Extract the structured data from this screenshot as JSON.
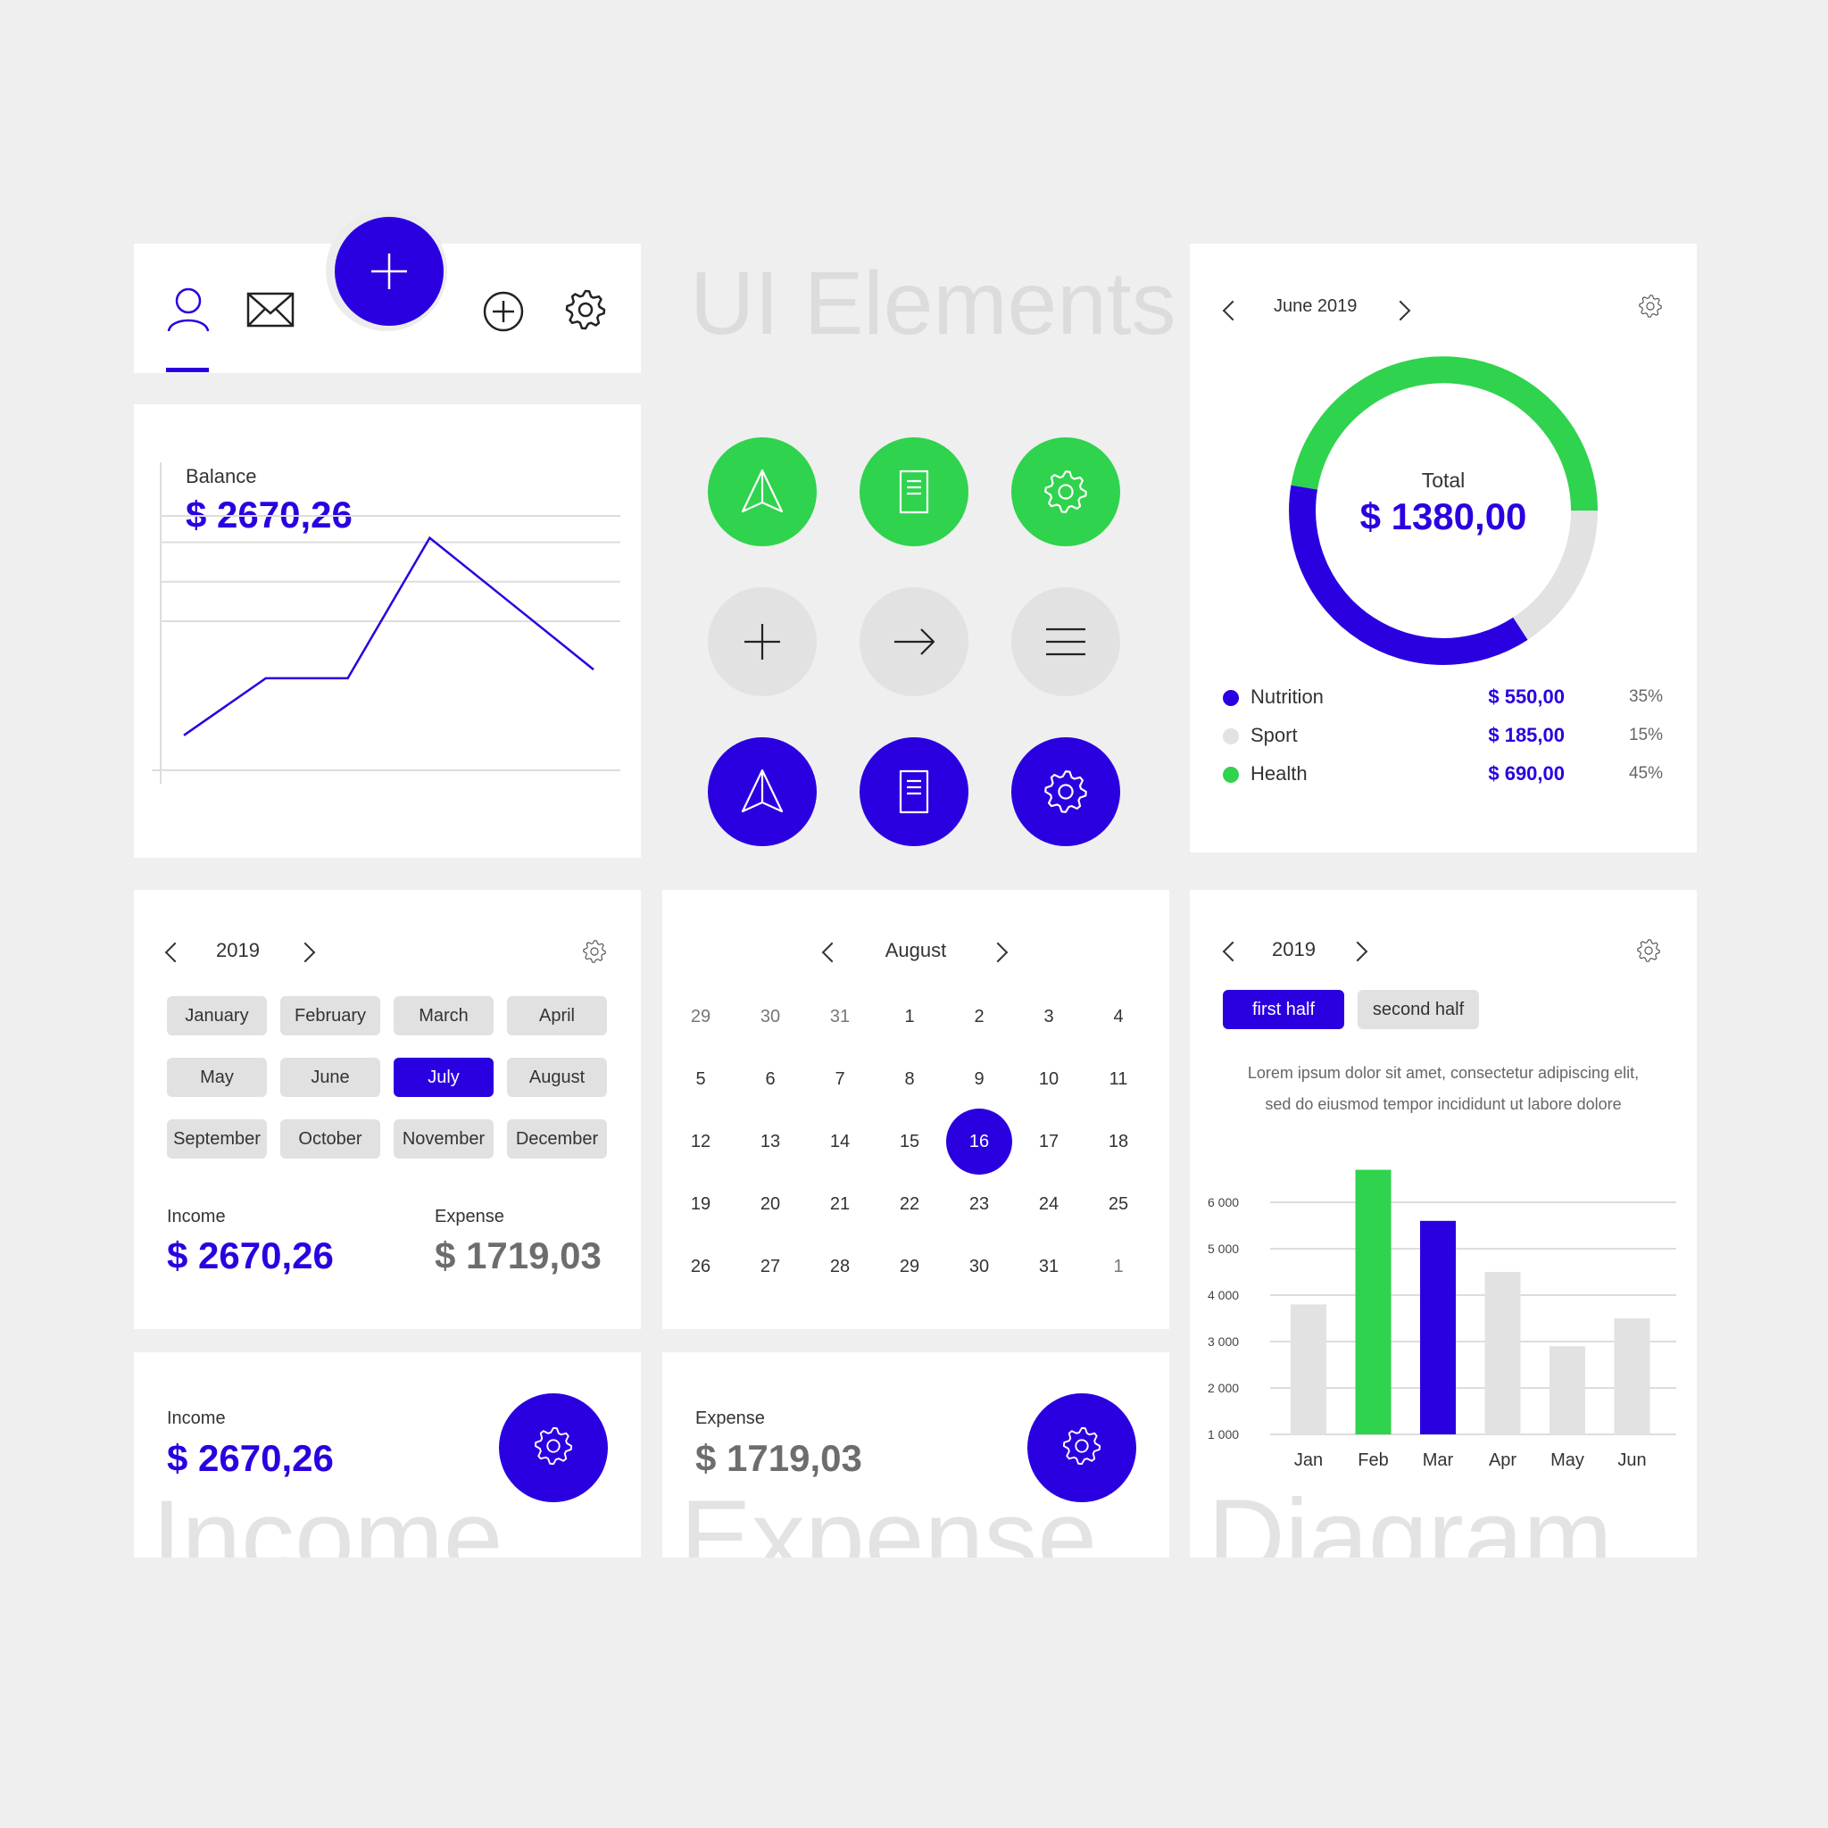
{
  "header": {
    "title": "UI Elements"
  },
  "nav": {
    "icons": [
      "user-icon",
      "mail-icon",
      "plus-icon",
      "plus-circle-icon",
      "gear-icon"
    ],
    "active_index": 0
  },
  "balance": {
    "label": "Balance",
    "amount": "$ 2670,26"
  },
  "balance_chart": {
    "type": "line",
    "x": [
      0,
      1,
      2,
      3,
      4,
      5
    ],
    "values": [
      1,
      2.3,
      2.3,
      5.5,
      4.0,
      2.5
    ],
    "ylim": [
      0,
      6
    ],
    "grid": true
  },
  "action_buttons": {
    "rows": [
      {
        "style": "green",
        "icons": [
          "send-icon",
          "document-icon",
          "gear-icon"
        ]
      },
      {
        "style": "gray",
        "icons": [
          "plus-icon",
          "arrow-right-icon",
          "menu-icon"
        ]
      },
      {
        "style": "blue",
        "icons": [
          "send-icon",
          "document-icon",
          "gear-icon"
        ]
      }
    ]
  },
  "donut": {
    "month": "June 2019",
    "total_label": "Total",
    "total_amount": "$ 1380,00",
    "legend": [
      {
        "name": "Nutrition",
        "amount": "$ 550,00",
        "percent": "35%",
        "color": "#2b00e0"
      },
      {
        "name": "Sport",
        "amount": "$ 185,00",
        "percent": "15%",
        "color": "#e2e2e2"
      },
      {
        "name": "Health",
        "amount": "$ 690,00",
        "percent": "45%",
        "color": "#2fd34d"
      }
    ]
  },
  "chart_data": [
    {
      "type": "pie",
      "categories": [
        "Nutrition",
        "Sport",
        "Health"
      ],
      "values": [
        35,
        15,
        45
      ]
    },
    {
      "type": "bar",
      "categories": [
        "Jan",
        "Feb",
        "Mar",
        "Apr",
        "May",
        "Jun"
      ],
      "values": [
        3800,
        6700,
        5600,
        4500,
        2900,
        3500
      ],
      "ylim": [
        1000,
        6000
      ],
      "yticks": [
        "6 000",
        "5 000",
        "4 000",
        "3 000",
        "2 000",
        "1 000"
      ],
      "colors": [
        "#e2e2e2",
        "#2fd34d",
        "#2b00e0",
        "#e2e2e2",
        "#e2e2e2",
        "#e2e2e2"
      ]
    }
  ],
  "months_card": {
    "year": "2019",
    "months": [
      "January",
      "February",
      "March",
      "April",
      "May",
      "June",
      "July",
      "August",
      "September",
      "October",
      "November",
      "December"
    ],
    "selected": "July",
    "income_label": "Income",
    "income_amount": "$ 2670,26",
    "expense_label": "Expense",
    "expense_amount": "$ 1719,03"
  },
  "calendar": {
    "month": "August",
    "days": [
      "29",
      "30",
      "31",
      "1",
      "2",
      "3",
      "4",
      "5",
      "6",
      "7",
      "8",
      "9",
      "10",
      "11",
      "12",
      "13",
      "14",
      "15",
      "16",
      "17",
      "18",
      "19",
      "20",
      "21",
      "22",
      "23",
      "24",
      "25",
      "26",
      "27",
      "28",
      "29",
      "30",
      "31",
      "1"
    ],
    "muted_indices": [
      0,
      1,
      2,
      34
    ],
    "selected": "16"
  },
  "bar_card": {
    "year": "2019",
    "tabs": [
      "first half",
      "second half"
    ],
    "active_tab": "first half",
    "description_line1": "Lorem ipsum dolor sit amet, consectetur adipiscing elit,",
    "description_line2": "sed do eiusmod tempor incididunt ut labore dolore"
  },
  "income_card": {
    "label": "Income",
    "amount": "$ 2670,26",
    "watermark": "Income"
  },
  "expense_card": {
    "label": "Expense",
    "amount": "$ 1719,03",
    "watermark": "Expense"
  },
  "diagram_watermark": "Diagram",
  "colors": {
    "blue": "#2b00e0",
    "green": "#2fd34d",
    "gray": "#e2e2e2"
  }
}
